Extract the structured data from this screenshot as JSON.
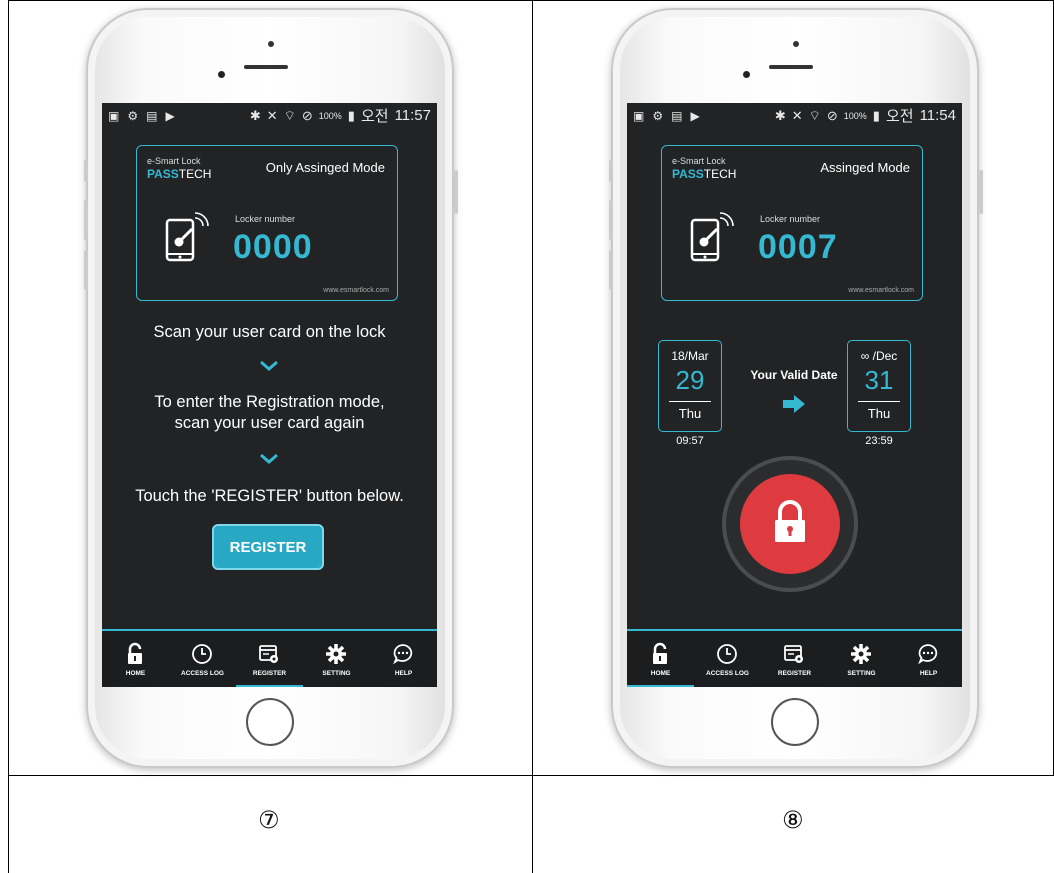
{
  "captions": {
    "left": "⑦",
    "right": "⑧"
  },
  "status_bar": {
    "battery": "100%",
    "ampm": "오전",
    "time_left": "11:57",
    "time_right": "11:54"
  },
  "card_left": {
    "brand_sub": "e-Smart Lock",
    "brand_pass": "PASS",
    "brand_tech": "TECH",
    "mode": "Only Assinged Mode",
    "locker_label": "Locker number",
    "locker_number": "0000",
    "website": "www.esmartlock.com"
  },
  "card_right": {
    "brand_sub": "e-Smart Lock",
    "brand_pass": "PASS",
    "brand_tech": "TECH",
    "mode": "Assinged Mode",
    "locker_label": "Locker number",
    "locker_number": "0007",
    "website": "www.esmartlock.com"
  },
  "instructions": {
    "step1": "Scan your user card on the lock",
    "step2_line1": "To enter the Registration mode,",
    "step2_line2": "scan your user card again",
    "step3": "Touch the 'REGISTER' button below.",
    "register_button": "REGISTER"
  },
  "valid_date": {
    "label": "Your Valid Date",
    "start": {
      "month": "18/Mar",
      "day": "29",
      "weekday": "Thu",
      "time": "09:57"
    },
    "end": {
      "month": "∞ /Dec",
      "day": "31",
      "weekday": "Thu",
      "time": "23:59"
    }
  },
  "nav": {
    "home": "HOME",
    "access_log": "ACCESS LOG",
    "register": "REGISTER",
    "setting": "SETTING",
    "help": "HELP"
  },
  "colors": {
    "accent": "#35b9d2",
    "background": "#212325",
    "lock_red": "#dd3b3f",
    "button": "#29a8c4"
  }
}
